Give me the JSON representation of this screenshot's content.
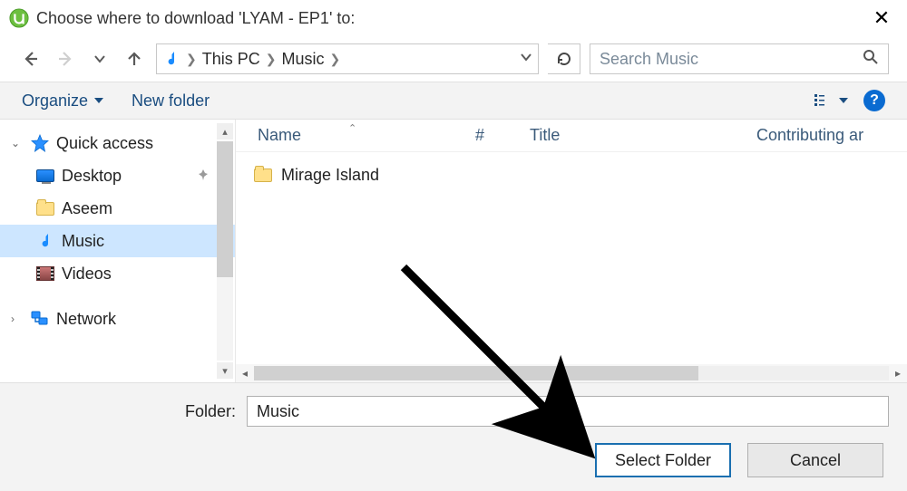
{
  "title": "Choose where to download 'LYAM - EP1' to:",
  "breadcrumb": {
    "root": "This PC",
    "current": "Music"
  },
  "search_placeholder": "Search Music",
  "toolbar": {
    "organize": "Organize",
    "new_folder": "New folder"
  },
  "sidebar": {
    "quick_access": "Quick access",
    "items": [
      {
        "label": "Desktop",
        "icon": "desktop",
        "pinned": true
      },
      {
        "label": "Aseem",
        "icon": "folder"
      },
      {
        "label": "Music",
        "icon": "music",
        "selected": true
      },
      {
        "label": "Videos",
        "icon": "video"
      }
    ],
    "network": "Network"
  },
  "columns": {
    "name": "Name",
    "num": "#",
    "title": "Title",
    "contributing": "Contributing ar"
  },
  "rows": [
    {
      "name": "Mirage Island",
      "icon": "folder"
    }
  ],
  "footer": {
    "folder_label": "Folder:",
    "folder_value": "Music",
    "select": "Select Folder",
    "cancel": "Cancel"
  }
}
